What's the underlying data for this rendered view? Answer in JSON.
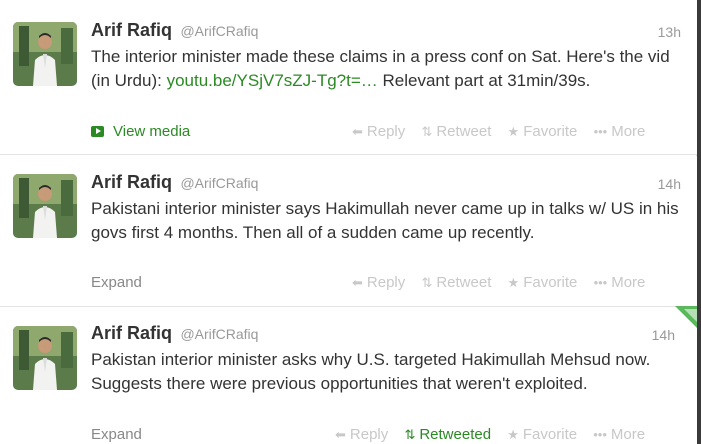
{
  "tweets": [
    {
      "fullname": "Arif Rafiq",
      "username": "@ArifCRafiq",
      "time": "13h",
      "text_before": "The interior minister made these claims in a press conf on Sat. Here's the vid (in Urdu): ",
      "link": "youtu.be/YSjV7sZJ-Tg?t=…",
      "text_after": " Relevant part at 31min/39s.",
      "footer_link": "View media",
      "actions": {
        "reply": "Reply",
        "retweet": "Retweet",
        "favorite": "Favorite",
        "more": "More"
      }
    },
    {
      "fullname": "Arif Rafiq",
      "username": "@ArifCRafiq",
      "time": "14h",
      "text": "Pakistani interior minister says Hakimullah never came up in talks w/ US in his govs first 4 months. Then all of a sudden came up recently.",
      "footer_link": "Expand",
      "actions": {
        "reply": "Reply",
        "retweet": "Retweet",
        "favorite": "Favorite",
        "more": "More"
      }
    },
    {
      "fullname": "Arif Rafiq",
      "username": "@ArifCRafiq",
      "time": "14h",
      "text": "Pakistan interior minister asks why U.S. targeted Hakimullah Mehsud now. Suggests there were previous opportunities that weren't exploited.",
      "footer_link": "Expand",
      "actions": {
        "reply": "Reply",
        "retweet": "Retweeted",
        "favorite": "Favorite",
        "more": "More"
      }
    }
  ],
  "icons": {
    "reply": "reply-arrow-icon",
    "retweet": "retweet-icon",
    "favorite": "star-icon",
    "more": "more-dots-icon",
    "media": "play-media-icon"
  },
  "colors": {
    "link": "#2b8a24",
    "retweeted": "#2b8a24",
    "muted": "#c8c8c8",
    "username": "#999999"
  }
}
